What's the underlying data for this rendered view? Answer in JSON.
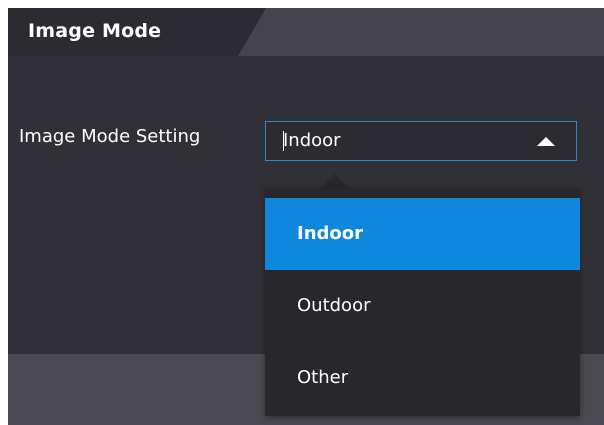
{
  "panel": {
    "title": "Image Mode"
  },
  "form": {
    "image_mode_label": "Image Mode Setting",
    "image_mode_value": "Indoor"
  },
  "dropdown": {
    "options": [
      {
        "label": "Indoor",
        "selected": true
      },
      {
        "label": "Outdoor",
        "selected": false
      },
      {
        "label": "Other",
        "selected": false
      }
    ]
  },
  "colors": {
    "accent": "#0d88dc",
    "select_border": "#2a89d6",
    "panel_background": "#303036"
  },
  "icons": {
    "dropdown_arrow": "triangle-up-icon"
  }
}
